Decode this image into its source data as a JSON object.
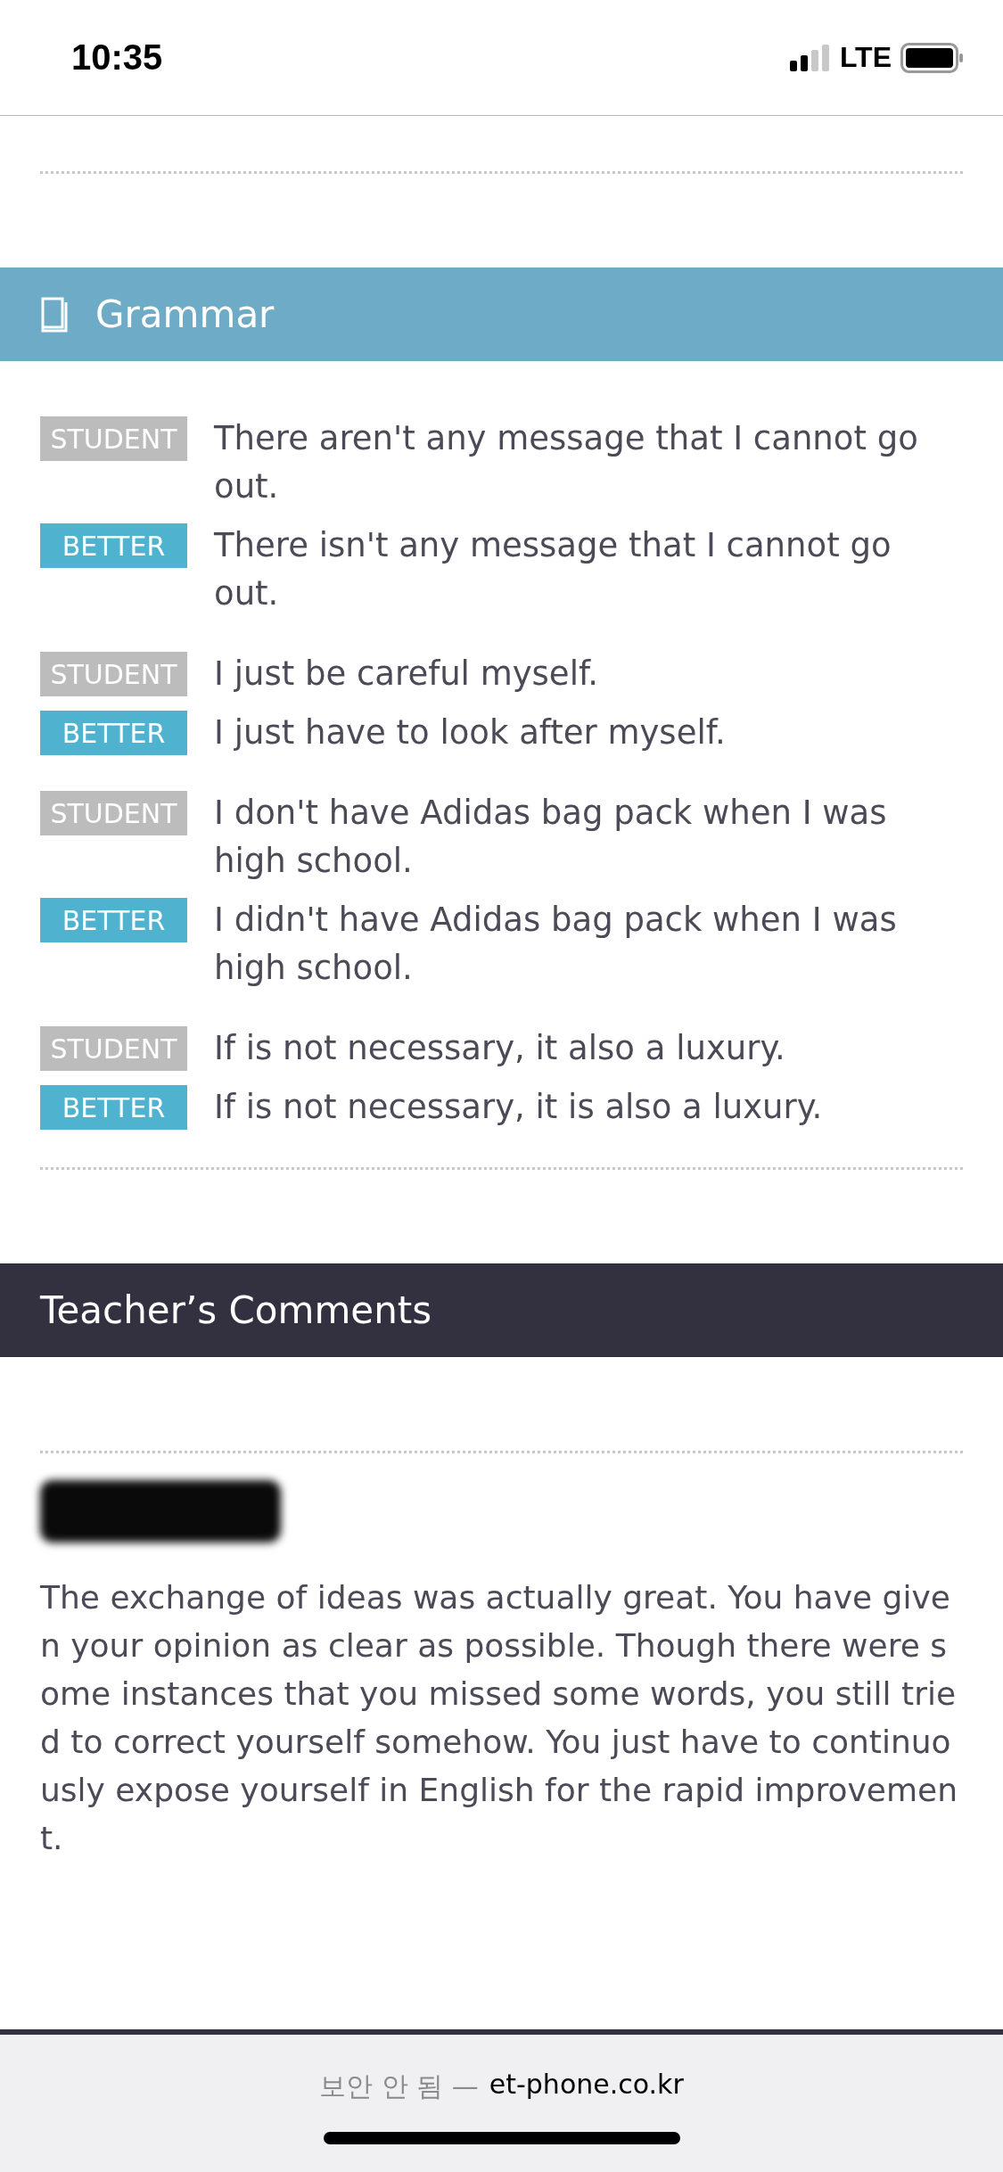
{
  "status_bar": {
    "time": "10:35",
    "network": "LTE"
  },
  "grammar": {
    "title": "Grammar",
    "items": [
      {
        "student_label": "STUDENT",
        "student": "There aren't any message that I cannot go out.",
        "better_label": "BETTER",
        "better": "There isn't any message that I cannot go out."
      },
      {
        "student_label": "STUDENT",
        "student": "I just be careful myself.",
        "better_label": "BETTER",
        "better": "I just have to look after myself."
      },
      {
        "student_label": "STUDENT",
        "student": "I don't have Adidas bag pack when I was high school.",
        "better_label": "BETTER",
        "better": "I didn't have Adidas bag pack when I was high school."
      },
      {
        "student_label": "STUDENT",
        "student": "If is not necessary, it also a luxury.",
        "better_label": "BETTER",
        "better": "If is not necessary, it is also a luxury."
      }
    ]
  },
  "teacher_comments": {
    "title": "Teacher’s Comments",
    "body": "The exchange of ideas was actually great. You have given your opinion as clear as possible. Though there were some instances that you missed some words, you still tried to correct yourself somehow. You just have to continuously expose yourself in English for the rapid improvement."
  },
  "browser_bar": {
    "security": "보안 안 됨 —",
    "domain": "et-phone.co.kr"
  }
}
